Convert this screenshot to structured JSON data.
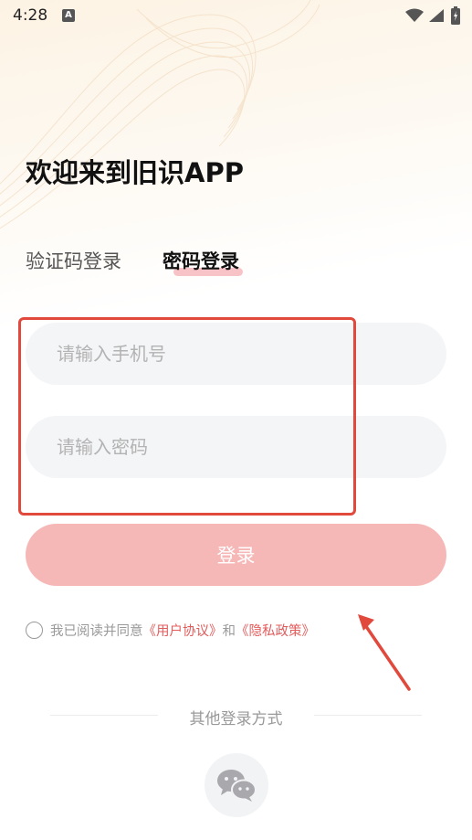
{
  "status_bar": {
    "time": "4:28",
    "notification_icon": "A",
    "icons": [
      "wifi-icon",
      "signal-icon",
      "battery-icon"
    ]
  },
  "title": "欢迎来到旧识APP",
  "tabs": [
    {
      "label": "验证码登录",
      "active": false
    },
    {
      "label": "密码登录",
      "active": true
    }
  ],
  "form": {
    "phone_placeholder": "请输入手机号",
    "password_placeholder": "请输入密码",
    "phone_value": "",
    "password_value": ""
  },
  "login_button": "登录",
  "agreement": {
    "prefix": "我已阅读并同意",
    "user_agreement": "《用户协议》",
    "and": "和",
    "privacy_policy": "《隐私政策》",
    "checked": false
  },
  "other_login": {
    "label": "其他登录方式",
    "methods": [
      "wechat-icon"
    ]
  },
  "colors": {
    "accent": "#f6b7b7",
    "link": "#e25c5c",
    "annotation": "#e0493c",
    "field_bg": "#f4f5f7",
    "tab_underline": "#f7b9bd"
  }
}
